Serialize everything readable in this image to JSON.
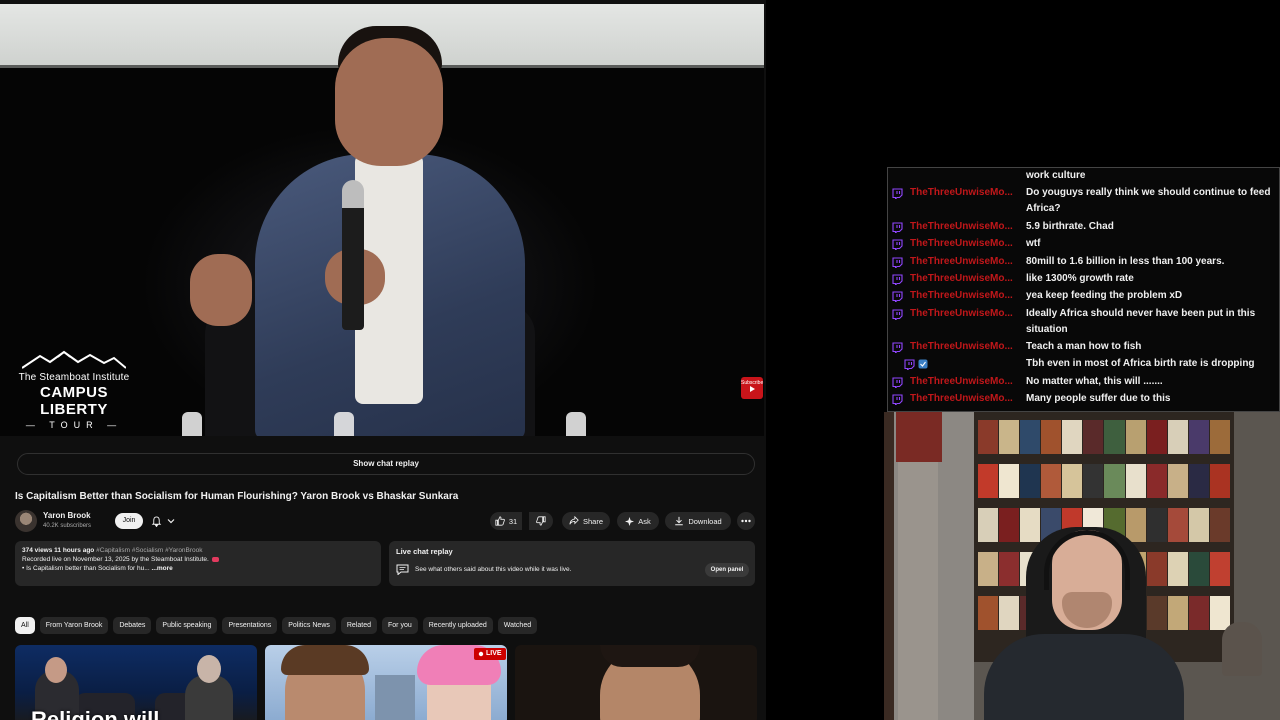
{
  "player": {
    "logo_subtitle": "The Steamboat Institute",
    "logo_title": "CAMPUS LIBERTY",
    "logo_tour": "TOUR",
    "subscribe_badge": "Subscribe"
  },
  "show_chat_replay": "Show chat replay",
  "video": {
    "title": "Is Capitalism Better than Socialism for Human Flourishing? Yaron Brook vs Bhaskar Sunkara",
    "channel_name": "Yaron Brook",
    "channel_subs": "40.2K subscribers",
    "join_label": "Join",
    "like_count": "31",
    "share_label": "Share",
    "ask_label": "Ask",
    "download_label": "Download"
  },
  "description": {
    "views_time": "374 views  11 hours ago",
    "tags": "#Capitalism #Socialism #YaronBrook",
    "recorded": "Recorded live on November 13, 2025 by the Steamboat Institute.",
    "snippet": "• Is Capitalism better than Socialism for hu...",
    "more": "...more"
  },
  "live_chat_replay": {
    "title": "Live chat replay",
    "description": "See what others said about this video while it was live.",
    "button": "Open panel"
  },
  "chips": [
    "All",
    "From Yaron Brook",
    "Debates",
    "Public speaking",
    "Presentations",
    "Politics News",
    "Related",
    "For you",
    "Recently uploaded",
    "Watched"
  ],
  "thumbnails": {
    "first_text": "Religion will",
    "live_label": "LIVE"
  },
  "chat": {
    "first_line": "work culture",
    "messages": [
      {
        "user": "TheThreeUnwiseMo...",
        "text": "Do youguys really think we should continue to feed Africa?"
      },
      {
        "user": "TheThreeUnwiseMo...",
        "text": "5.9 birthrate. Chad"
      },
      {
        "user": "TheThreeUnwiseMo...",
        "text": "wtf"
      },
      {
        "user": "TheThreeUnwiseMo...",
        "text": "80mill to 1.6 billion in less than 100 years."
      },
      {
        "user": "TheThreeUnwiseMo...",
        "text": "like 1300% growth rate"
      },
      {
        "user": "TheThreeUnwiseMo...",
        "text": "yea keep feeding the problem xD"
      },
      {
        "user": "TheThreeUnwiseMo...",
        "text": "Ideally Africa should never have been put in this situation"
      },
      {
        "user": "TheThreeUnwiseMo...",
        "text": "Teach a man how to fish"
      },
      {
        "user": "",
        "text": "Tbh even in most of Africa birth rate is dropping"
      },
      {
        "user": "TheThreeUnwiseMo...",
        "text": "No matter what, this will ......."
      },
      {
        "user": "TheThreeUnwiseMo...",
        "text": "Many people suffer due to this"
      }
    ]
  },
  "colors": {
    "yt_bg": "#0f0f0f",
    "pill_bg": "#272727",
    "chat_user": "#c1171a",
    "twitch_purple": "#9146ff",
    "live_red": "#cc0000"
  }
}
